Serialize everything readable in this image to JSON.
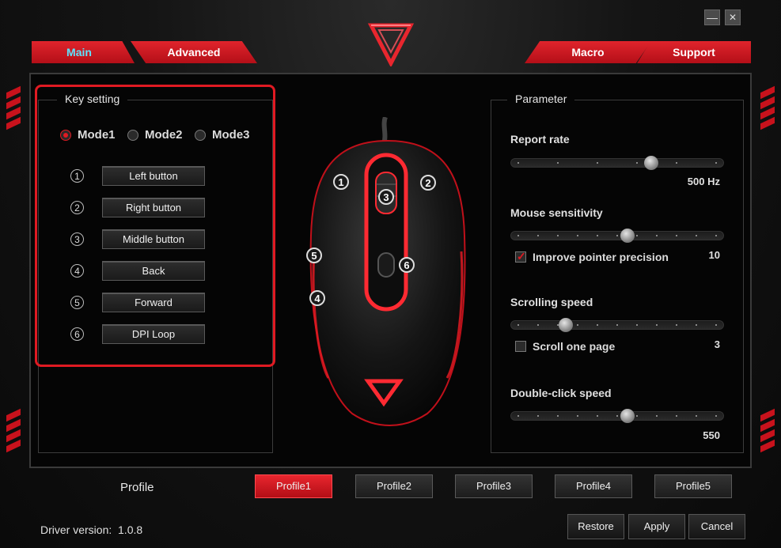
{
  "window": {
    "minimize_glyph": "—",
    "close_glyph": "✕"
  },
  "tabs": [
    {
      "label": "Main",
      "active": true
    },
    {
      "label": "Advanced",
      "active": false
    },
    {
      "label": "Macro",
      "active": false
    },
    {
      "label": "Support",
      "active": false
    }
  ],
  "key_setting": {
    "title": "Key setting",
    "modes": [
      {
        "label": "Mode1",
        "selected": true
      },
      {
        "label": "Mode2",
        "selected": false
      },
      {
        "label": "Mode3",
        "selected": false
      }
    ],
    "buttons": [
      {
        "num": "1",
        "label": "Left button"
      },
      {
        "num": "2",
        "label": "Right button"
      },
      {
        "num": "3",
        "label": "Middle button"
      },
      {
        "num": "4",
        "label": "Back"
      },
      {
        "num": "5",
        "label": "Forward"
      },
      {
        "num": "6",
        "label": "DPI Loop"
      }
    ]
  },
  "mouse_markers": [
    "1",
    "2",
    "3",
    "4",
    "5",
    "6"
  ],
  "parameter": {
    "title": "Parameter",
    "report_rate": {
      "label": "Report rate",
      "value": "500 Hz",
      "position": 0.67
    },
    "mouse_sensitivity": {
      "label": "Mouse sensitivity",
      "value": "10",
      "position": 0.55
    },
    "improve_precision": {
      "label": "Improve pointer precision",
      "checked": true
    },
    "scrolling_speed": {
      "label": "Scrolling speed",
      "value": "3",
      "position": 0.24
    },
    "scroll_one_page": {
      "label": "Scroll one page",
      "checked": false
    },
    "double_click_speed": {
      "label": "Double-click speed",
      "value": "550",
      "position": 0.55
    }
  },
  "profile": {
    "label": "Profile",
    "items": [
      {
        "label": "Profile1",
        "active": true
      },
      {
        "label": "Profile2",
        "active": false
      },
      {
        "label": "Profile3",
        "active": false
      },
      {
        "label": "Profile4",
        "active": false
      },
      {
        "label": "Profile5",
        "active": false
      }
    ]
  },
  "footer": {
    "driver_version": "Driver version:  1.0.8"
  },
  "actions": {
    "restore": "Restore",
    "apply": "Apply",
    "cancel": "Cancel"
  },
  "colors": {
    "accent": "#e01a22",
    "tab_active_text": "#5ee3ff"
  }
}
